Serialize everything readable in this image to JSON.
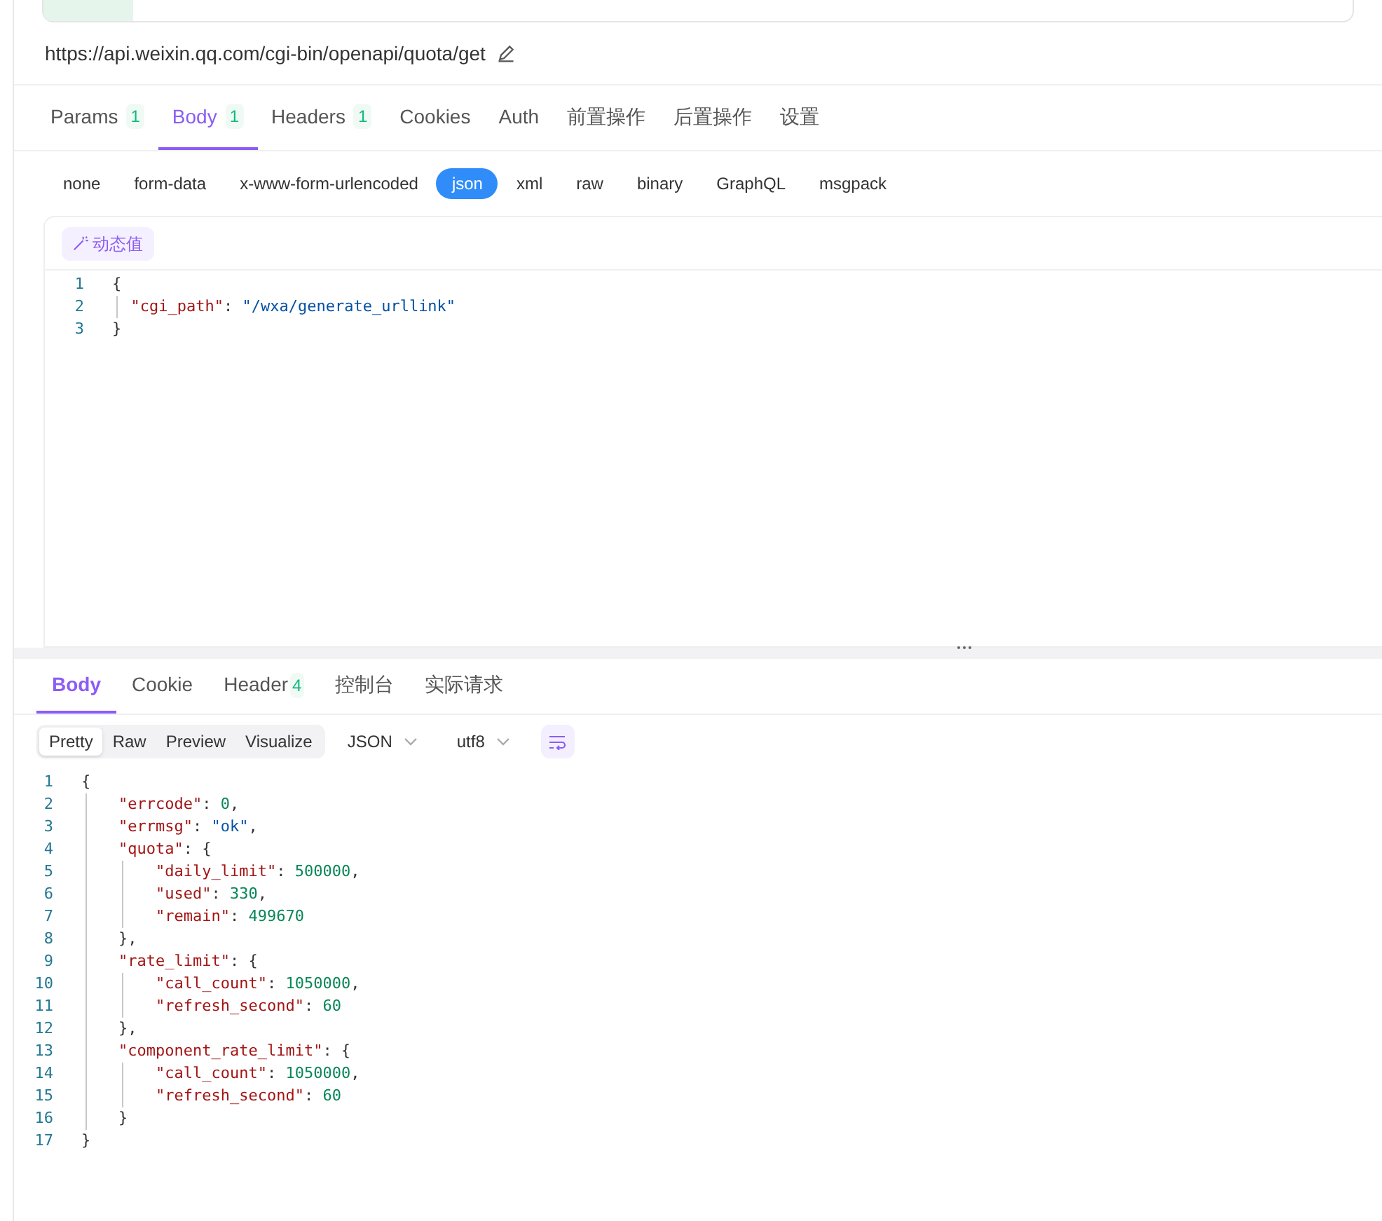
{
  "request": {
    "url": "https://api.weixin.qq.com/cgi-bin/openapi/quota/get",
    "tabs": [
      {
        "label": "Params",
        "count": "1",
        "selected": false
      },
      {
        "label": "Body",
        "count": "1",
        "selected": true
      },
      {
        "label": "Headers",
        "count": "1",
        "selected": false
      },
      {
        "label": "Cookies",
        "selected": false
      },
      {
        "label": "Auth",
        "selected": false
      },
      {
        "label": "前置操作",
        "selected": false
      },
      {
        "label": "后置操作",
        "selected": false
      },
      {
        "label": "设置",
        "selected": false
      }
    ],
    "body_types": [
      {
        "label": "none",
        "selected": false
      },
      {
        "label": "form-data",
        "selected": false
      },
      {
        "label": "x-www-form-urlencoded",
        "selected": false
      },
      {
        "label": "json",
        "selected": true
      },
      {
        "label": "xml",
        "selected": false
      },
      {
        "label": "raw",
        "selected": false
      },
      {
        "label": "binary",
        "selected": false
      },
      {
        "label": "GraphQL",
        "selected": false
      },
      {
        "label": "msgpack",
        "selected": false
      }
    ],
    "dynamic_button": "动态值",
    "code": [
      {
        "number": "1",
        "tokens": [
          {
            "kind": "punct",
            "text": "{"
          }
        ]
      },
      {
        "number": "2",
        "tokens": [
          {
            "kind": "key",
            "text": "  \"cgi_path\""
          },
          {
            "kind": "punct",
            "text": ": "
          },
          {
            "kind": "string",
            "text": "\"/wxa/generate_urllink\""
          }
        ]
      },
      {
        "number": "3",
        "tokens": [
          {
            "kind": "punct",
            "text": "}"
          }
        ]
      }
    ]
  },
  "response": {
    "tabs": [
      {
        "label": "Body",
        "selected": true
      },
      {
        "label": "Cookie",
        "selected": false
      },
      {
        "label": "Header",
        "count": "4",
        "selected": false
      },
      {
        "label": "控制台",
        "selected": false
      },
      {
        "label": "实际请求",
        "selected": false
      }
    ],
    "views": [
      {
        "label": "Pretty",
        "selected": true
      },
      {
        "label": "Raw",
        "selected": false
      },
      {
        "label": "Preview",
        "selected": false
      },
      {
        "label": "Visualize",
        "selected": false
      }
    ],
    "format": "JSON",
    "encoding": "utf8",
    "code": [
      {
        "number": "1",
        "tokens": [
          {
            "kind": "punct",
            "text": "{"
          }
        ]
      },
      {
        "number": "2",
        "tokens": [
          {
            "kind": "key",
            "text": "    \"errcode\""
          },
          {
            "kind": "punct",
            "text": ": "
          },
          {
            "kind": "number",
            "text": "0"
          },
          {
            "kind": "punct",
            "text": ","
          }
        ]
      },
      {
        "number": "3",
        "tokens": [
          {
            "kind": "key",
            "text": "    \"errmsg\""
          },
          {
            "kind": "punct",
            "text": ": "
          },
          {
            "kind": "string",
            "text": "\"ok\""
          },
          {
            "kind": "punct",
            "text": ","
          }
        ]
      },
      {
        "number": "4",
        "tokens": [
          {
            "kind": "key",
            "text": "    \"quota\""
          },
          {
            "kind": "punct",
            "text": ": {"
          }
        ]
      },
      {
        "number": "5",
        "tokens": [
          {
            "kind": "key",
            "text": "        \"daily_limit\""
          },
          {
            "kind": "punct",
            "text": ": "
          },
          {
            "kind": "number",
            "text": "500000"
          },
          {
            "kind": "punct",
            "text": ","
          }
        ]
      },
      {
        "number": "6",
        "tokens": [
          {
            "kind": "key",
            "text": "        \"used\""
          },
          {
            "kind": "punct",
            "text": ": "
          },
          {
            "kind": "number",
            "text": "330"
          },
          {
            "kind": "punct",
            "text": ","
          }
        ]
      },
      {
        "number": "7",
        "tokens": [
          {
            "kind": "key",
            "text": "        \"remain\""
          },
          {
            "kind": "punct",
            "text": ": "
          },
          {
            "kind": "number",
            "text": "499670"
          }
        ]
      },
      {
        "number": "8",
        "tokens": [
          {
            "kind": "punct",
            "text": "    },"
          }
        ]
      },
      {
        "number": "9",
        "tokens": [
          {
            "kind": "key",
            "text": "    \"rate_limit\""
          },
          {
            "kind": "punct",
            "text": ": {"
          }
        ]
      },
      {
        "number": "10",
        "tokens": [
          {
            "kind": "key",
            "text": "        \"call_count\""
          },
          {
            "kind": "punct",
            "text": ": "
          },
          {
            "kind": "number",
            "text": "1050000"
          },
          {
            "kind": "punct",
            "text": ","
          }
        ]
      },
      {
        "number": "11",
        "tokens": [
          {
            "kind": "key",
            "text": "        \"refresh_second\""
          },
          {
            "kind": "punct",
            "text": ": "
          },
          {
            "kind": "number",
            "text": "60"
          }
        ]
      },
      {
        "number": "12",
        "tokens": [
          {
            "kind": "punct",
            "text": "    },"
          }
        ]
      },
      {
        "number": "13",
        "tokens": [
          {
            "kind": "key",
            "text": "    \"component_rate_limit\""
          },
          {
            "kind": "punct",
            "text": ": {"
          }
        ]
      },
      {
        "number": "14",
        "tokens": [
          {
            "kind": "key",
            "text": "        \"call_count\""
          },
          {
            "kind": "punct",
            "text": ": "
          },
          {
            "kind": "number",
            "text": "1050000"
          },
          {
            "kind": "punct",
            "text": ","
          }
        ]
      },
      {
        "number": "15",
        "tokens": [
          {
            "kind": "key",
            "text": "        \"refresh_second\""
          },
          {
            "kind": "punct",
            "text": ": "
          },
          {
            "kind": "number",
            "text": "60"
          }
        ]
      },
      {
        "number": "16",
        "tokens": [
          {
            "kind": "punct",
            "text": "    }"
          }
        ]
      },
      {
        "number": "17",
        "tokens": [
          {
            "kind": "punct",
            "text": "}"
          }
        ]
      }
    ]
  }
}
